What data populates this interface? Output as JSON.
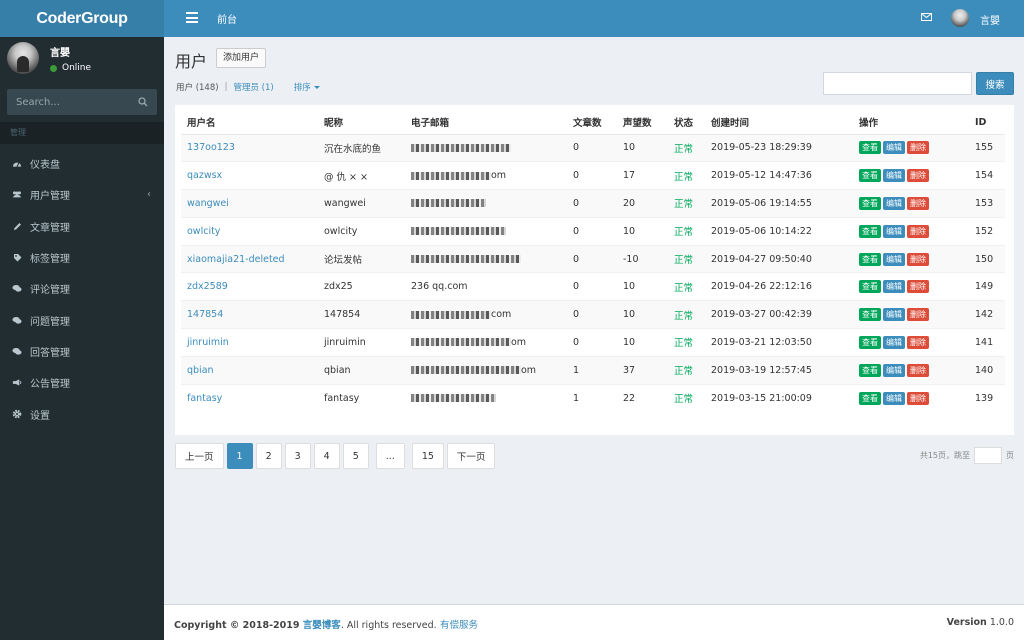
{
  "app": {
    "logo": "CoderGroup"
  },
  "sidebar": {
    "user_name": "言嬰",
    "status": "Online",
    "search_placeholder": "Search...",
    "section_header": "管理",
    "items": [
      {
        "label": "仪表盘",
        "icon": "dashboard-icon"
      },
      {
        "label": "用户管理",
        "icon": "users-icon",
        "has_children": true
      },
      {
        "label": "文章管理",
        "icon": "pencil-icon"
      },
      {
        "label": "标签管理",
        "icon": "tag-icon"
      },
      {
        "label": "评论管理",
        "icon": "comments-icon"
      },
      {
        "label": "问题管理",
        "icon": "question-icon"
      },
      {
        "label": "回答管理",
        "icon": "answer-icon"
      },
      {
        "label": "公告管理",
        "icon": "bullhorn-icon"
      },
      {
        "label": "设置",
        "icon": "gear-icon"
      }
    ]
  },
  "topbar": {
    "nav": "前台",
    "user_name": "言嬰"
  },
  "page": {
    "title": "用户",
    "add_button": "添加用户",
    "filter_users": "用户 (148)",
    "filter_separator": "|",
    "filter_admins": "管理员 (1)",
    "sort": "排序",
    "search_button": "搜索"
  },
  "table": {
    "headers": [
      "用户名",
      "昵称",
      "电子邮箱",
      "文章数",
      "声望数",
      "状态",
      "创建时间",
      "操作",
      "ID"
    ],
    "actions": {
      "view": "查看",
      "edit": "编辑",
      "delete": "删除"
    },
    "rows": [
      {
        "username": "137oo123",
        "nickname": "沉在水底的鱼",
        "email": "",
        "email_blur": 100,
        "articles": "0",
        "reputation": "10",
        "status": "正常",
        "created": "2019-05-23 18:29:39",
        "id": "155"
      },
      {
        "username": "qazwsx",
        "nickname": "@ 仇 × ×",
        "email": "om",
        "email_blur": 80,
        "articles": "0",
        "reputation": "17",
        "status": "正常",
        "created": "2019-05-12 14:47:36",
        "id": "154"
      },
      {
        "username": "wangwei",
        "nickname": "wangwei",
        "email": "",
        "email_blur": 75,
        "articles": "0",
        "reputation": "20",
        "status": "正常",
        "created": "2019-05-06 19:14:55",
        "id": "153"
      },
      {
        "username": "owlcity",
        "nickname": "owlcity",
        "email": "",
        "email_blur": 95,
        "articles": "0",
        "reputation": "10",
        "status": "正常",
        "created": "2019-05-06 10:14:22",
        "id": "152"
      },
      {
        "username": "xiaomajia21-deleted",
        "nickname": "论坛发帖",
        "email": "",
        "email_blur": 110,
        "articles": "0",
        "reputation": "-10",
        "status": "正常",
        "created": "2019-04-27 09:50:40",
        "id": "150"
      },
      {
        "username": "zdx2589",
        "nickname": "zdx25",
        "email": "236 qq.com",
        "email_blur": 0,
        "articles": "0",
        "reputation": "10",
        "status": "正常",
        "created": "2019-04-26 22:12:16",
        "id": "149"
      },
      {
        "username": "147854",
        "nickname": "147854",
        "email": "com",
        "email_blur": 80,
        "articles": "0",
        "reputation": "10",
        "status": "正常",
        "created": "2019-03-27 00:42:39",
        "id": "142"
      },
      {
        "username": "jinruimin",
        "nickname": "jinruimin",
        "email": "om",
        "email_blur": 100,
        "articles": "0",
        "reputation": "10",
        "status": "正常",
        "created": "2019-03-21 12:03:50",
        "id": "141"
      },
      {
        "username": "qbian",
        "nickname": "qbian",
        "email": "om",
        "email_blur": 110,
        "articles": "1",
        "reputation": "37",
        "status": "正常",
        "created": "2019-03-19 12:57:45",
        "id": "140"
      },
      {
        "username": "fantasy",
        "nickname": "fantasy",
        "email": "",
        "email_blur": 85,
        "articles": "1",
        "reputation": "22",
        "status": "正常",
        "created": "2019-03-15 21:00:09",
        "id": "139"
      }
    ]
  },
  "pagination": {
    "prev": "上一页",
    "pages": [
      "1",
      "2",
      "3",
      "4",
      "5"
    ],
    "ellipsis": "...",
    "last": "15",
    "next": "下一页",
    "active": "1",
    "summary": "共15页，跳至",
    "page_unit": "页"
  },
  "footer": {
    "copyright": "Copyright © 2018-2019",
    "site": "言嬰博客",
    "rights": ". All rights reserved.",
    "service": "有偿服务",
    "version_label": "Version",
    "version": "1.0.0"
  },
  "colors": {
    "accent": "#3c8dbc",
    "success": "#00a65a",
    "danger": "#dd4b39",
    "sidebar": "#222d32"
  }
}
